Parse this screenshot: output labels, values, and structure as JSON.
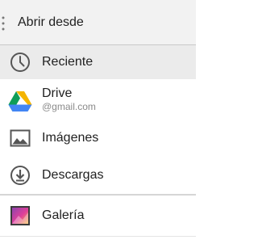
{
  "header": {
    "title": "Abrir desde",
    "menu_icon": "overflow-dots-icon"
  },
  "items": [
    {
      "label": "Reciente",
      "icon": "clock-icon",
      "selected": true
    },
    {
      "label": "Drive",
      "sublabel": "@gmail.com",
      "icon": "google-drive-icon"
    },
    {
      "label": "Imágenes",
      "icon": "image-icon"
    },
    {
      "label": "Descargas",
      "icon": "download-icon"
    },
    {
      "label": "Galería",
      "icon": "gallery-app-icon"
    }
  ],
  "colors": {
    "header_bg": "#f2f2f2",
    "selected_bg": "#ebebeb",
    "drive_yellow": "#f4b400",
    "drive_green": "#0f9d58",
    "drive_blue": "#4285f4"
  }
}
